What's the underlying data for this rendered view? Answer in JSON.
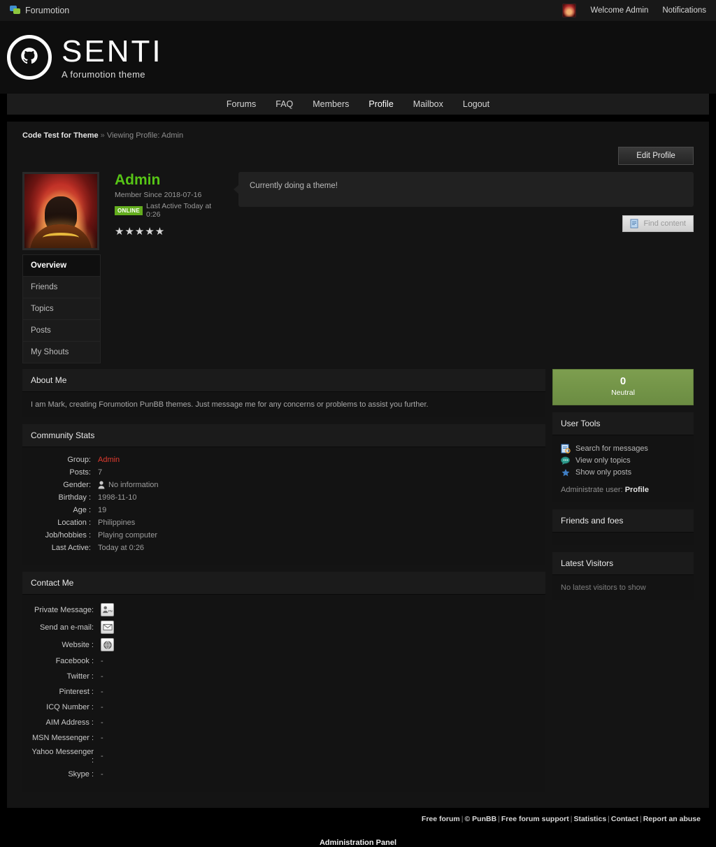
{
  "topbar": {
    "brand": "Forumotion",
    "brand_icon": "forumotion-chat-icon",
    "welcome": "Welcome Admin",
    "notifications": "Notifications"
  },
  "logo": {
    "title": "SENTI",
    "subtitle": "A forumotion theme",
    "mark_icon": "octocat-circle-icon"
  },
  "nav": {
    "items": [
      {
        "label": "Forums",
        "active": false
      },
      {
        "label": "FAQ",
        "active": false
      },
      {
        "label": "Members",
        "active": false
      },
      {
        "label": "Profile",
        "active": true
      },
      {
        "label": "Mailbox",
        "active": false
      },
      {
        "label": "Logout",
        "active": false
      }
    ]
  },
  "breadcrumb": {
    "home": "Code Test for Theme",
    "separator": "»",
    "current": "Viewing Profile: Admin"
  },
  "actions": {
    "edit_profile": "Edit Profile",
    "find_content": "Find content"
  },
  "profile": {
    "username": "Admin",
    "member_since": "Member Since 2018-07-16",
    "status_badge": "ONLINE",
    "last_active_label": "Last Active Today at 0:26",
    "stars": "★★★★★",
    "mood": "Currently doing a theme!"
  },
  "side_tabs": {
    "items": [
      {
        "label": "Overview",
        "active": true
      },
      {
        "label": "Friends",
        "active": false
      },
      {
        "label": "Topics",
        "active": false
      },
      {
        "label": "Posts",
        "active": false
      },
      {
        "label": "My Shouts",
        "active": false
      }
    ]
  },
  "about": {
    "title": "About Me",
    "text": "I am Mark, creating Forumotion PunBB themes. Just message me for any concerns or problems to assist you further."
  },
  "community_stats": {
    "title": "Community Stats",
    "rows": [
      {
        "key": "Group:",
        "value": "Admin",
        "accent": true
      },
      {
        "key": "Posts:",
        "value": "7",
        "accent": false
      },
      {
        "key": "Gender:",
        "value": "No information",
        "accent": false,
        "icon": "person-icon"
      },
      {
        "key": "Birthday :",
        "value": "1998-11-10",
        "accent": false
      },
      {
        "key": "Age :",
        "value": "19",
        "accent": false
      },
      {
        "key": "Location :",
        "value": "Philippines",
        "accent": false
      },
      {
        "key": "Job/hobbies :",
        "value": "Playing computer",
        "accent": false
      },
      {
        "key": "Last Active:",
        "value": "Today at 0:26",
        "accent": false
      }
    ]
  },
  "contact": {
    "title": "Contact Me",
    "rows": [
      {
        "key": "Private Message:",
        "value": "",
        "icon": "pm-icon"
      },
      {
        "key": "Send an e-mail:",
        "value": "",
        "icon": "email-icon"
      },
      {
        "key": "Website :",
        "value": "",
        "icon": "globe-icon"
      },
      {
        "key": "Facebook :",
        "value": "-",
        "icon": ""
      },
      {
        "key": "Twitter :",
        "value": "-",
        "icon": ""
      },
      {
        "key": "Pinterest :",
        "value": "-",
        "icon": ""
      },
      {
        "key": "ICQ Number :",
        "value": "-",
        "icon": ""
      },
      {
        "key": "AIM Address :",
        "value": "-",
        "icon": ""
      },
      {
        "key": "MSN Messenger :",
        "value": "-",
        "icon": ""
      },
      {
        "key": "Yahoo Messenger :",
        "value": "-",
        "icon": ""
      },
      {
        "key": "Skype :",
        "value": "-",
        "icon": ""
      }
    ]
  },
  "reputation": {
    "value": "0",
    "label": "Neutral",
    "color": "#7d9e4f"
  },
  "user_tools": {
    "title": "User Tools",
    "items": [
      {
        "label": "Search for messages",
        "icon": "document-search-icon"
      },
      {
        "label": "View only topics",
        "icon": "topics-icon"
      },
      {
        "label": "Show only posts",
        "icon": "star-icon"
      }
    ],
    "administrate_label": "Administrate user:",
    "administrate_link": "Profile"
  },
  "friends_foes": {
    "title": "Friends and foes"
  },
  "latest_visitors": {
    "title": "Latest Visitors",
    "empty": "No latest visitors to show"
  },
  "footer": {
    "links": [
      "Free forum",
      "© PunBB",
      "Free forum support",
      "Statistics",
      "Contact",
      "Report an abuse"
    ],
    "admin_panel": "Administration Panel"
  },
  "colors": {
    "accent_green": "#57c516",
    "admin_red": "#e03b2f",
    "online_badge": "#63ad1e",
    "page_bg": "#141414"
  }
}
